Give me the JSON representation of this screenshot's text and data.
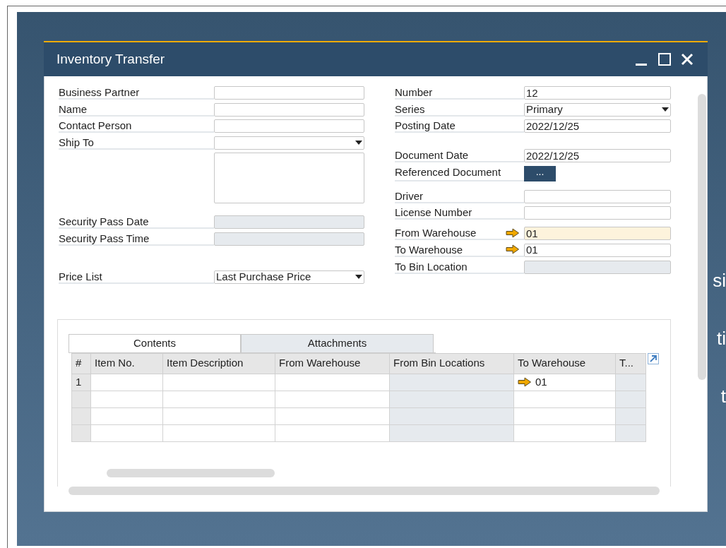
{
  "window": {
    "title": "Inventory Transfer"
  },
  "left_groups": [
    [
      {
        "label": "Business Partner",
        "kind": "text",
        "disabled": false
      },
      {
        "label": "Name",
        "kind": "text",
        "disabled": false
      },
      {
        "label": "Contact Person",
        "kind": "text",
        "disabled": false
      },
      {
        "label": "Ship To",
        "kind": "select",
        "disabled": false
      },
      {
        "kind": "textarea",
        "disabled": false
      }
    ],
    [
      {
        "label": "Security Pass Date",
        "kind": "text",
        "disabled": true
      },
      {
        "label": "Security Pass Time",
        "kind": "text",
        "disabled": true
      }
    ],
    [
      {
        "label": "Price List",
        "kind": "select",
        "value": "Last Purchase Price",
        "disabled": false
      }
    ]
  ],
  "right_groups": [
    [
      {
        "label": "Number",
        "kind": "text",
        "value": "12",
        "disabled": false,
        "focused": false,
        "linked": false
      },
      {
        "label": "Series",
        "kind": "select",
        "value": "Primary",
        "disabled": false,
        "focused": false,
        "linked": false
      },
      {
        "label": "Posting Date",
        "kind": "text",
        "value": "2022/12/25",
        "disabled": false,
        "focused": false,
        "linked": false
      }
    ],
    [
      {
        "label": "Document Date",
        "kind": "text",
        "value": "2022/12/25",
        "disabled": false,
        "focused": false,
        "linked": false
      },
      {
        "label": "Referenced Document",
        "kind": "button",
        "value": "..."
      }
    ],
    [
      {
        "label": "Driver",
        "kind": "text",
        "disabled": false,
        "focused": false,
        "linked": false
      },
      {
        "label": "License Number",
        "kind": "text",
        "disabled": false,
        "focused": false,
        "linked": false
      }
    ],
    [
      {
        "label": "From Warehouse",
        "kind": "text",
        "value": "01",
        "disabled": false,
        "focused": true,
        "linked": true
      },
      {
        "label": "To Warehouse",
        "kind": "text",
        "value": "01",
        "disabled": false,
        "focused": false,
        "linked": true
      },
      {
        "label": "To Bin Location",
        "kind": "text",
        "disabled": true,
        "focused": false,
        "linked": false
      }
    ]
  ],
  "tabs": [
    {
      "label": "Contents",
      "selected": true
    },
    {
      "label": "Attachments",
      "selected": false
    }
  ],
  "table": {
    "columns": [
      {
        "label": "#"
      },
      {
        "label": "Item No.",
        "disabled": false
      },
      {
        "label": "Item Description",
        "disabled": false
      },
      {
        "label": "From Warehouse",
        "disabled": false
      },
      {
        "label": "From Bin Locations",
        "disabled": true
      },
      {
        "label": "To Warehouse",
        "disabled": false
      },
      {
        "label": "T...",
        "disabled": true
      }
    ],
    "rows": [
      {
        "cells": [
          {
            "value": "1",
            "linked": false
          },
          null,
          null,
          null,
          null,
          {
            "value": "01",
            "linked": true
          },
          null
        ]
      }
    ]
  },
  "desktop_texts": [
    "si",
    "ti",
    "t"
  ]
}
